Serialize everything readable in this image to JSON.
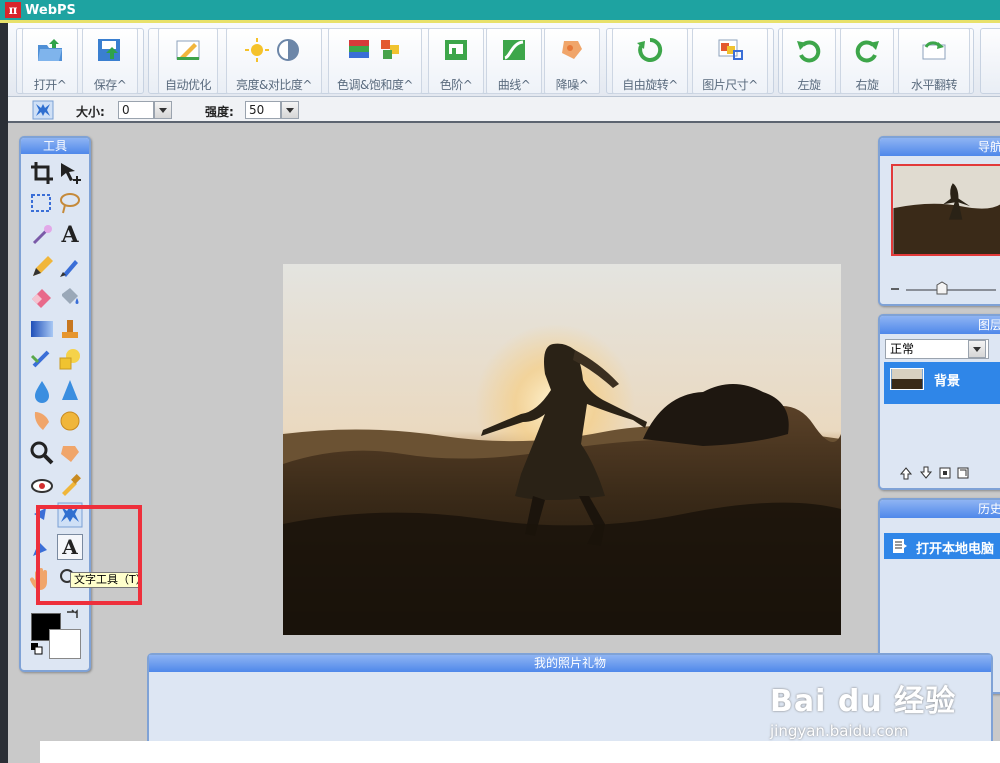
{
  "app": {
    "logo": "π",
    "title": "WebPS"
  },
  "toolbar": {
    "buttons": [
      {
        "id": "open",
        "label": "打开^",
        "icon": "folder-open-icon"
      },
      {
        "id": "save",
        "label": "保存^",
        "icon": "save-icon"
      },
      {
        "id": "auto",
        "label": "自动优化",
        "icon": "auto-optimize-icon"
      },
      {
        "id": "brightness",
        "label": "亮度&对比度^",
        "icon": "brightness-icon"
      },
      {
        "id": "hue",
        "label": "色调&饱和度^",
        "icon": "hue-saturation-icon"
      },
      {
        "id": "levels",
        "label": "色阶^",
        "icon": "levels-icon"
      },
      {
        "id": "curves",
        "label": "曲线^",
        "icon": "curves-icon"
      },
      {
        "id": "denoise",
        "label": "降噪^",
        "icon": "denoise-icon"
      },
      {
        "id": "freerotate",
        "label": "自由旋转^",
        "icon": "free-rotate-icon"
      },
      {
        "id": "imgsize",
        "label": "图片尺寸^",
        "icon": "image-size-icon"
      },
      {
        "id": "rotleft",
        "label": "左旋",
        "icon": "rotate-left-icon"
      },
      {
        "id": "rotright",
        "label": "右旋",
        "icon": "rotate-right-icon"
      },
      {
        "id": "fliph",
        "label": "水平翻转",
        "icon": "flip-horizontal-icon"
      }
    ]
  },
  "options": {
    "size_label": "大小:",
    "size_value": "0",
    "strength_label": "强度:",
    "strength_value": "50"
  },
  "tools_panel": {
    "title": "工具",
    "tooltip": "文字工具（T）"
  },
  "navigator": {
    "title": "导航"
  },
  "layers": {
    "title": "图层",
    "blend_mode": "正常",
    "layer_name": "背景"
  },
  "history": {
    "title": "历史",
    "item": "打开本地电脑"
  },
  "gift_panel": {
    "title": "我的照片礼物"
  },
  "watermark": {
    "main": "Bai du 经验",
    "sub": "jingyan.baidu.com"
  },
  "colors": {
    "foreground": "#000000",
    "background": "#ffffff",
    "accent": "#4f88ea"
  }
}
